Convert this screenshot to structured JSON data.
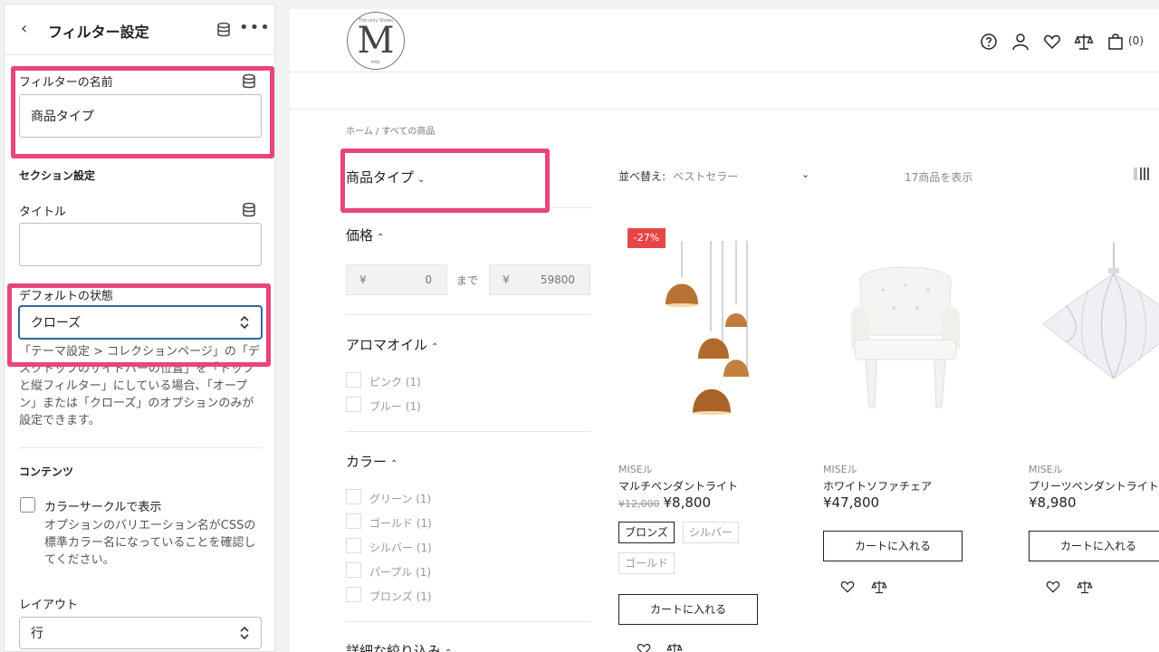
{
  "panel": {
    "title": "フィルター設定",
    "filter_name_label": "フィルターの名前",
    "filter_name_value": "商品タイプ",
    "section_settings": "セクション設定",
    "title_label": "タイトル",
    "title_value": "",
    "default_state_label": "デフォルトの状態",
    "default_state_value": "クローズ",
    "default_state_help": "「テーマ設定 > コレクションページ」の「デスクトップのサイドバーの位置」を「トップと縦フィルター」にしている場合、「オープン」または「クローズ」のオプションのみが設定できます。",
    "contents_label": "コンテンツ",
    "color_circle_label": "カラーサークルで表示",
    "color_circle_help": "オプションのバリエーション名がCSSの標準カラー名になっていることを確認してください。",
    "layout_label": "レイアウト",
    "layout_value": "行"
  },
  "store": {
    "logo_letter": "M",
    "logo_top": "The only Shoes",
    "logo_bottom": "MISE",
    "cart_count": "(0)",
    "breadcrumb": "ホーム  /  すべての商品",
    "filters": {
      "product_type": "商品タイプ",
      "price": "価格",
      "price_currency": "¥",
      "price_min": "0",
      "price_to": "まで",
      "price_max": "59800",
      "aroma": "アロマオイル",
      "aroma_options": [
        "ピンク (1)",
        "ブルー (1)"
      ],
      "color": "カラー",
      "color_options": [
        "グリーン (1)",
        "ゴールド (1)",
        "シルバー (1)",
        "パープル (1)",
        "ブロンズ (1)"
      ],
      "refine": "詳細な絞り込み"
    },
    "sort_label": "並べ替え:",
    "sort_value": "ベストセラー",
    "count": "17商品を表示",
    "products": [
      {
        "badge": "-27%",
        "vendor": "MISEル",
        "name": "マルチペンダントライト",
        "price_old": "¥12,000",
        "price": "¥8,800",
        "swatches": [
          "ブロンズ",
          "シルバー",
          "ゴールド"
        ],
        "cart": "カートに入れる"
      },
      {
        "vendor": "MISEル",
        "name": "ホワイトソファチェア",
        "price": "¥47,800",
        "cart": "カートに入れる"
      },
      {
        "vendor": "MISEル",
        "name": "プリーツペンダントライト",
        "price": "¥8,980",
        "cart": "カートに入れる"
      }
    ]
  },
  "colors": {
    "highlight": "#e8457b",
    "focus": "#356596",
    "badge": "#e64646",
    "copper": "#b87333"
  }
}
